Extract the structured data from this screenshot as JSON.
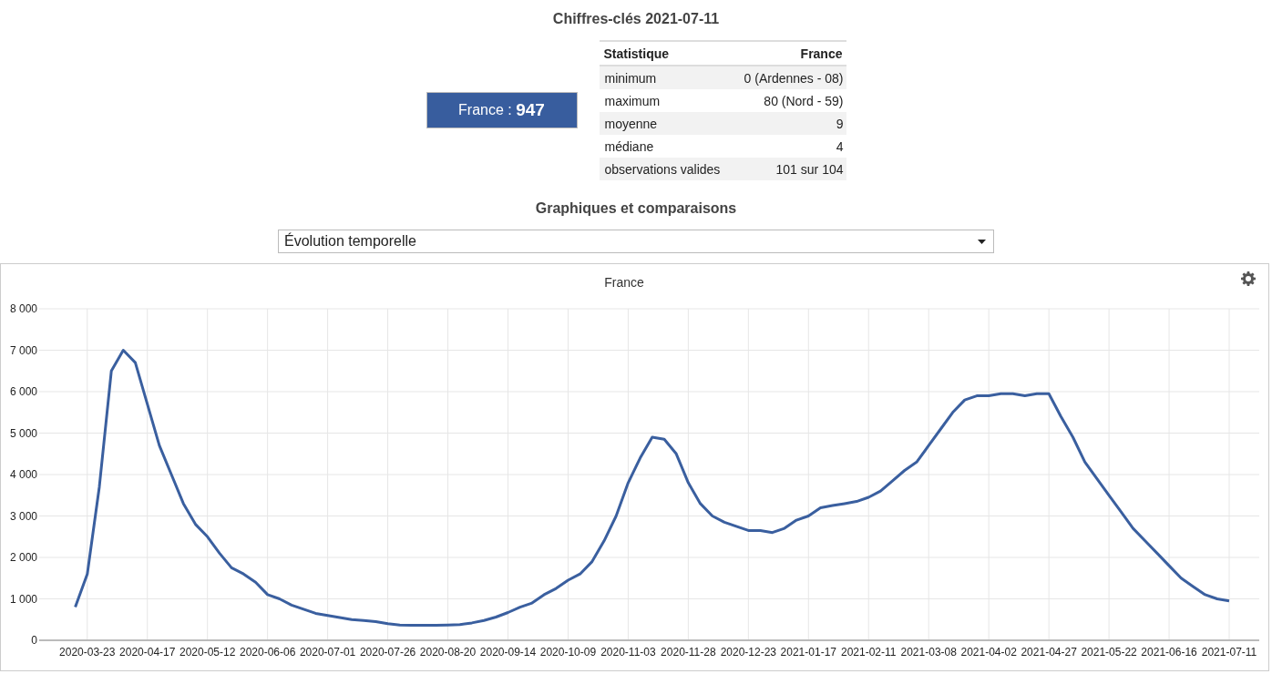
{
  "key_figures": {
    "title": "Chiffres-clés 2021-07-11",
    "total_label": "France : ",
    "total_value": "947",
    "table": {
      "columns": [
        "Statistique",
        "France"
      ],
      "rows": [
        {
          "label": "minimum",
          "value": "0 (Ardennes - 08)"
        },
        {
          "label": "maximum",
          "value": "80 (Nord - 59)"
        },
        {
          "label": "moyenne",
          "value": "9"
        },
        {
          "label": "médiane",
          "value": "4"
        },
        {
          "label": "observations valides",
          "value": "101 sur 104"
        }
      ]
    }
  },
  "charts_section": {
    "title": "Graphiques et comparaisons",
    "dropdown": {
      "value": "Évolution temporelle"
    },
    "chart_data": {
      "type": "line",
      "title": "France",
      "ylim": [
        0,
        8000
      ],
      "grid": true,
      "categories": [
        null,
        "2020-03-23",
        null,
        null,
        null,
        null,
        "2020-04-17",
        null,
        null,
        null,
        null,
        "2020-05-12",
        null,
        null,
        null,
        null,
        "2020-06-06",
        null,
        null,
        null,
        null,
        "2020-07-01",
        null,
        null,
        null,
        null,
        "2020-07-26",
        null,
        null,
        null,
        null,
        "2020-08-20",
        null,
        null,
        null,
        null,
        "2020-09-14",
        null,
        null,
        null,
        null,
        "2020-10-09",
        null,
        null,
        null,
        null,
        "2020-11-03",
        null,
        null,
        null,
        null,
        "2020-11-28",
        null,
        null,
        null,
        null,
        "2020-12-23",
        null,
        null,
        null,
        null,
        "2021-01-17",
        null,
        null,
        null,
        null,
        "2021-02-11",
        null,
        null,
        null,
        null,
        "2021-03-08",
        null,
        null,
        null,
        null,
        "2021-04-02",
        null,
        null,
        null,
        null,
        "2021-04-27",
        null,
        null,
        null,
        null,
        "2021-05-22",
        null,
        null,
        null,
        null,
        "2021-06-16",
        null,
        null,
        null,
        null,
        "2021-07-11"
      ],
      "series": [
        {
          "color": "#3a5f9f",
          "values": [
            800,
            1600,
            3700,
            6500,
            7000,
            6700,
            5700,
            4700,
            4000,
            3300,
            2800,
            2500,
            2100,
            1750,
            1600,
            1400,
            1100,
            1000,
            850,
            750,
            650,
            600,
            550,
            500,
            480,
            450,
            400,
            370,
            360,
            360,
            360,
            370,
            380,
            420,
            480,
            560,
            670,
            800,
            900,
            1100,
            1250,
            1450,
            1600,
            1900,
            2400,
            3000,
            3800,
            4400,
            4900,
            4850,
            4500,
            3800,
            3300,
            3000,
            2850,
            2750,
            2650,
            2650,
            2600,
            2700,
            2900,
            3000,
            3200,
            3250,
            3300,
            3350,
            3450,
            3600,
            3850,
            4100,
            4300,
            4700,
            5100,
            5500,
            5800,
            5900,
            5900,
            5950,
            5950,
            5900,
            5950,
            5950,
            5400,
            4900,
            4300,
            3900,
            3500,
            3100,
            2700,
            2400,
            2100,
            1800,
            1500,
            1300,
            1100,
            1000,
            950
          ]
        }
      ],
      "yticks": [
        {
          "value": 0,
          "label": "0"
        },
        {
          "value": 1000,
          "label": "1 000"
        },
        {
          "value": 2000,
          "label": "2 000"
        },
        {
          "value": 3000,
          "label": "3 000"
        },
        {
          "value": 4000,
          "label": "4 000"
        },
        {
          "value": 5000,
          "label": "5 000"
        },
        {
          "value": 6000,
          "label": "6 000"
        },
        {
          "value": 7000,
          "label": "7 000"
        },
        {
          "value": 8000,
          "label": "8 000"
        }
      ]
    }
  }
}
